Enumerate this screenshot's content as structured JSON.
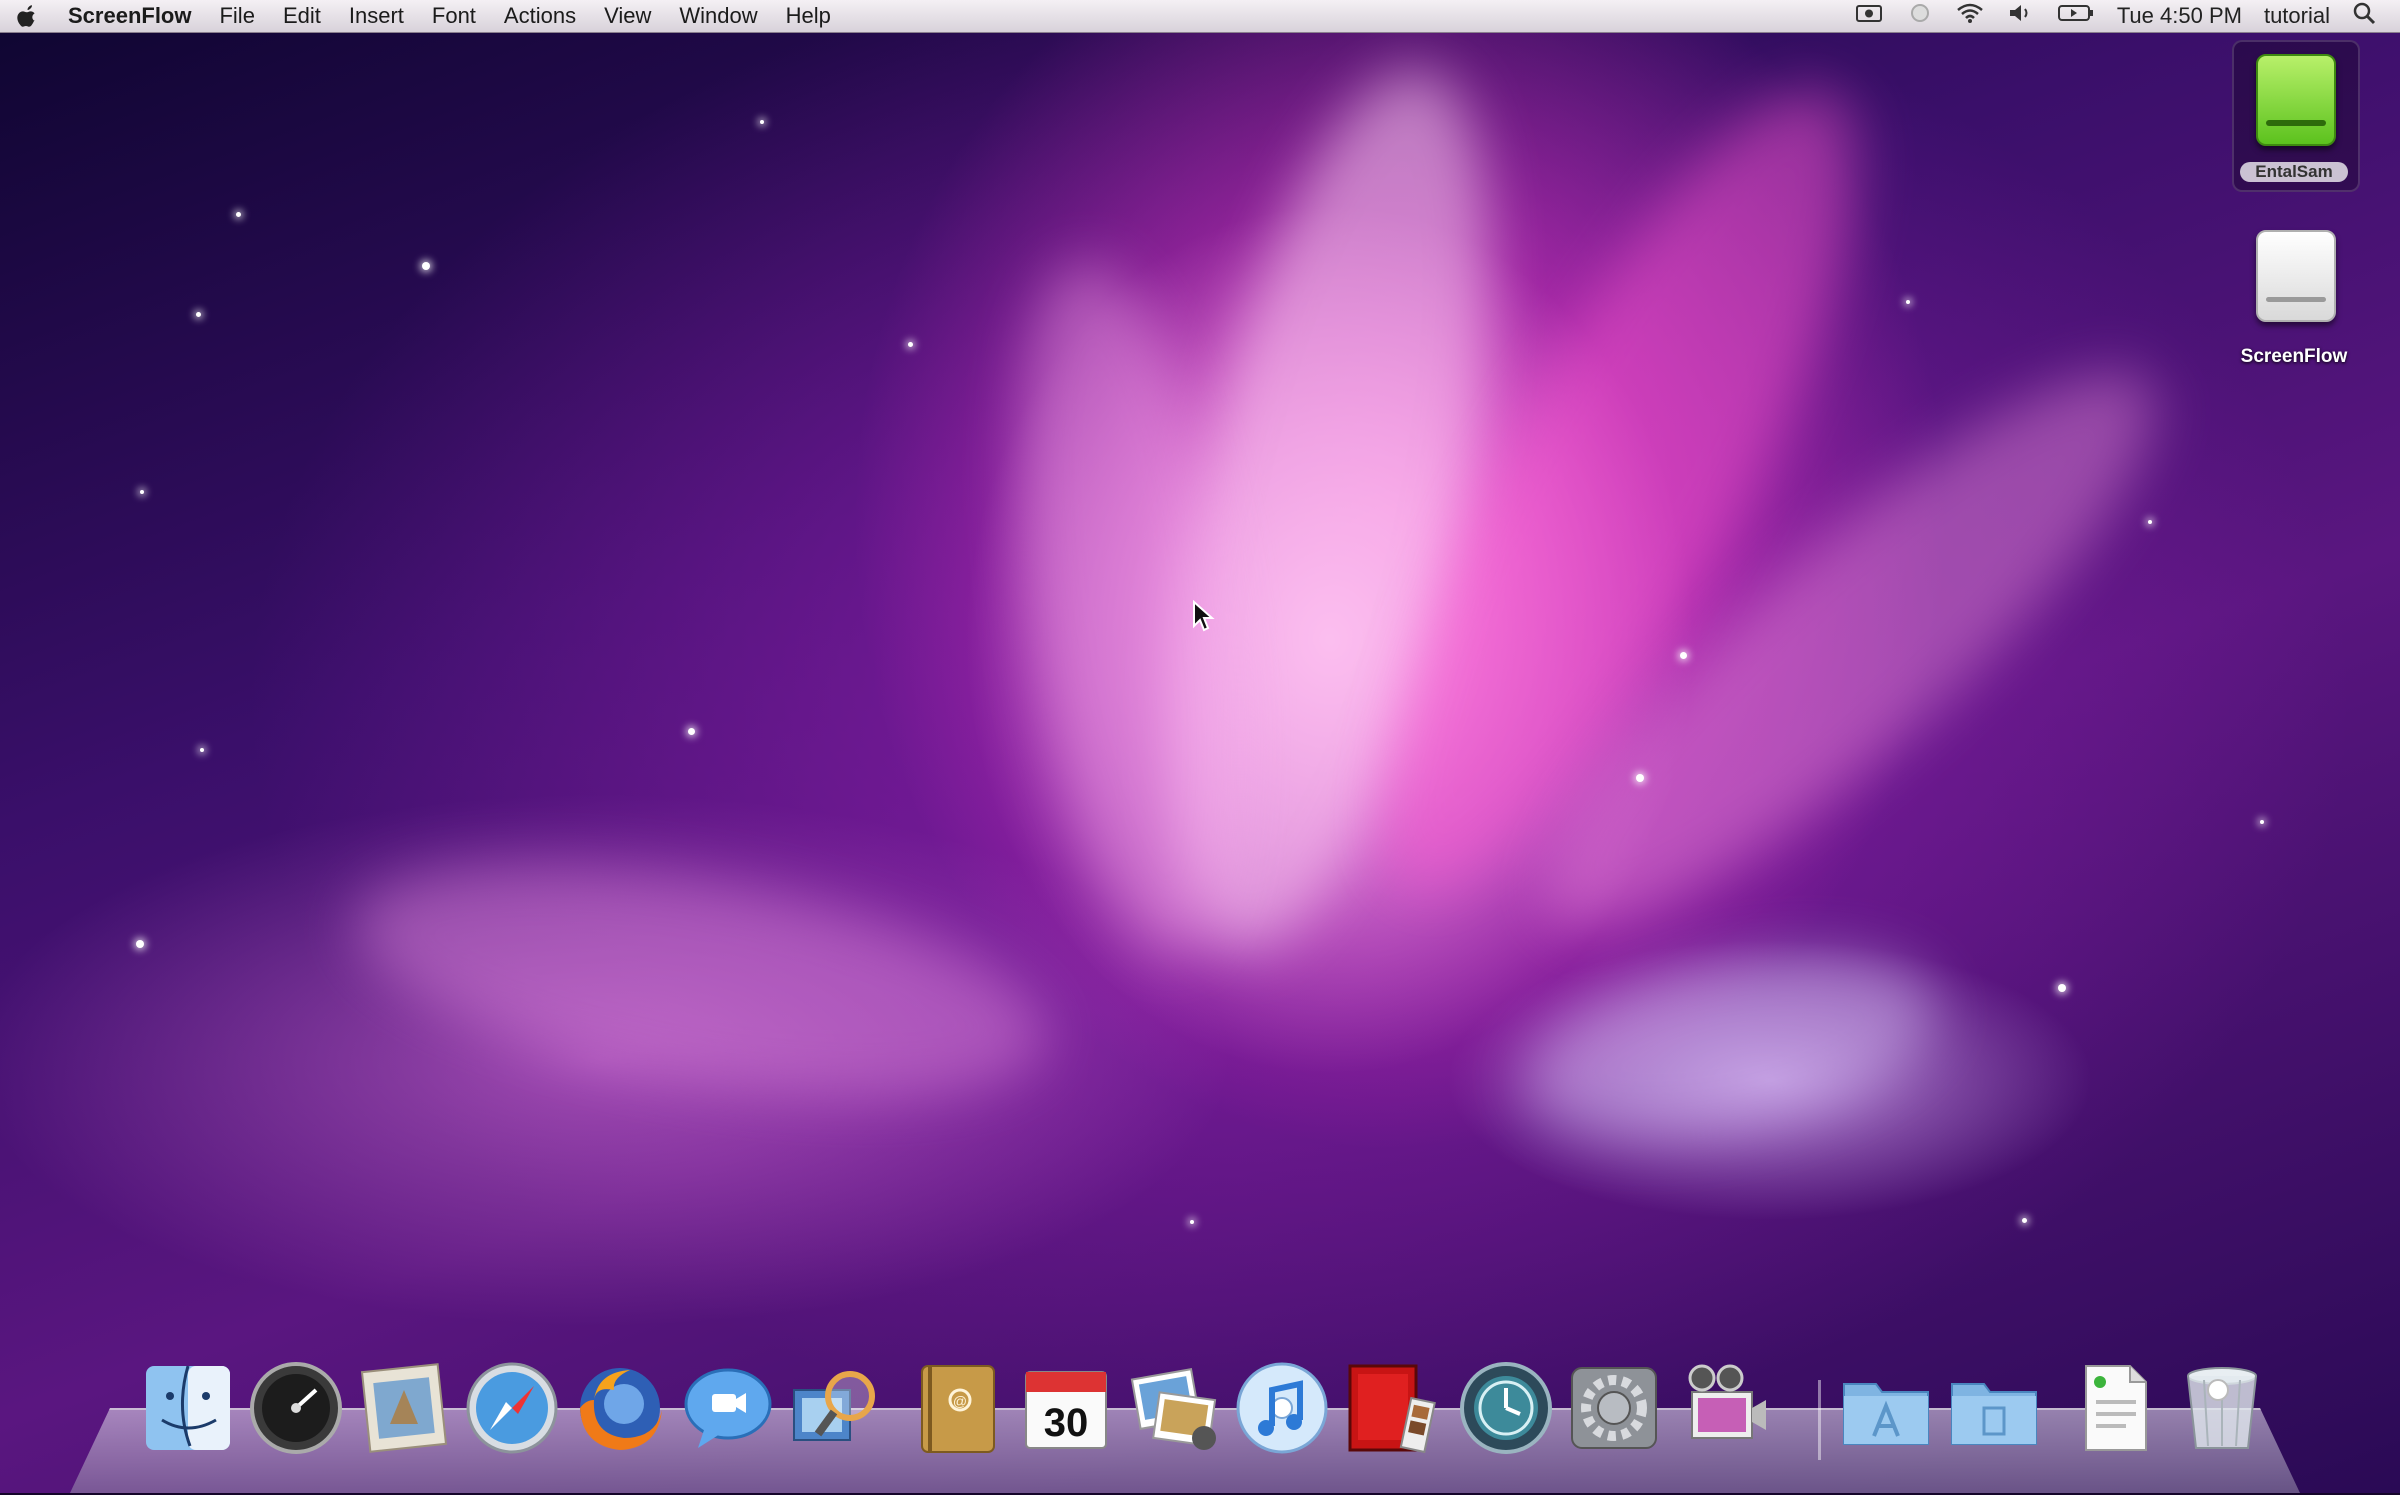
{
  "menubar": {
    "app_name": "ScreenFlow",
    "items": [
      "File",
      "Edit",
      "Insert",
      "Font",
      "Actions",
      "View",
      "Window",
      "Help"
    ],
    "clock": "Tue 4:50 PM",
    "user": "tutorial",
    "status_icons": [
      "screenflow-record-icon",
      "sync-icon",
      "wifi-icon",
      "volume-icon",
      "battery-icon",
      "spotlight-icon"
    ]
  },
  "desktop": {
    "volumes": [
      {
        "label": "EntalSam",
        "icon": "green-external-drive-icon",
        "selected": true
      },
      {
        "label": "ScreenFlow",
        "icon": "white-disk-image-icon",
        "selected": false
      }
    ]
  },
  "dock": {
    "items": [
      {
        "name": "finder",
        "icon": "finder-icon"
      },
      {
        "name": "dashboard",
        "icon": "dashboard-icon"
      },
      {
        "name": "mail",
        "icon": "mail-icon"
      },
      {
        "name": "safari",
        "icon": "safari-icon"
      },
      {
        "name": "firefox",
        "icon": "firefox-icon"
      },
      {
        "name": "ichat",
        "icon": "ichat-icon"
      },
      {
        "name": "preview",
        "icon": "preview-icon"
      },
      {
        "name": "address-book",
        "icon": "address-book-icon"
      },
      {
        "name": "ical",
        "icon": "ical-icon",
        "text": "30"
      },
      {
        "name": "iphoto",
        "icon": "iphoto-icon"
      },
      {
        "name": "itunes",
        "icon": "itunes-icon"
      },
      {
        "name": "photo-booth",
        "icon": "photo-booth-icon"
      },
      {
        "name": "time-machine",
        "icon": "time-machine-icon"
      },
      {
        "name": "system-preferences",
        "icon": "system-preferences-icon"
      },
      {
        "name": "screenflow",
        "icon": "screenflow-icon"
      },
      {
        "name": "applications-folder",
        "icon": "applications-folder-icon"
      },
      {
        "name": "documents-folder",
        "icon": "documents-folder-icon"
      },
      {
        "name": "downloads-stack",
        "icon": "downloads-stack-icon"
      },
      {
        "name": "trash",
        "icon": "trash-icon"
      }
    ]
  }
}
